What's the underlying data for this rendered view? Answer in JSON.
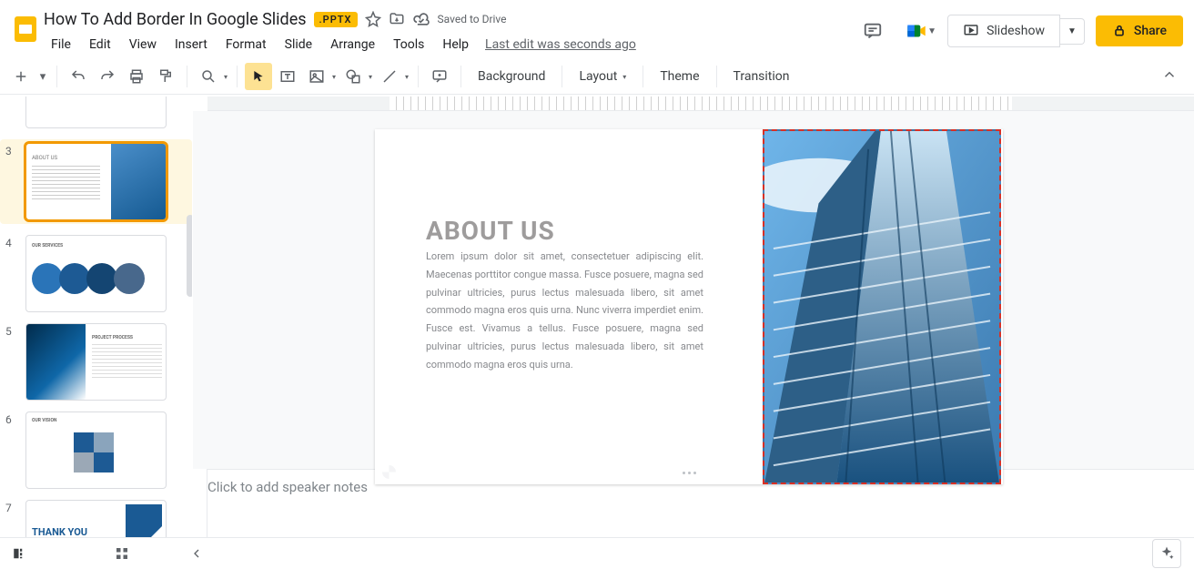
{
  "header": {
    "doc_title": "How To Add Border In Google Slides",
    "badge": ".PPTX",
    "saved_label": "Saved to Drive",
    "last_edit": "Last edit was seconds ago",
    "menus": [
      "File",
      "Edit",
      "View",
      "Insert",
      "Format",
      "Slide",
      "Arrange",
      "Tools",
      "Help"
    ],
    "slideshow_label": "Slideshow",
    "share_label": "Share"
  },
  "toolbar": {
    "background": "Background",
    "layout": "Layout",
    "theme": "Theme",
    "transition": "Transition"
  },
  "thumbnails": [
    {
      "num": "3",
      "title": "ABOUT US",
      "selected": true
    },
    {
      "num": "4",
      "title": "OUR SERVICES"
    },
    {
      "num": "5",
      "title": "PROJECT PROCESS"
    },
    {
      "num": "6",
      "title": "OUR VISION"
    },
    {
      "num": "7",
      "title": "THANK YOU"
    }
  ],
  "slide": {
    "title": "ABOUT US",
    "body": "Lorem ipsum dolor sit amet, consectetuer adipiscing elit. Maecenas porttitor congue massa. Fusce posuere, magna sed pulvinar ultricies, purus lectus malesuada libero, sit amet commodo magna eros quis urna. Nunc viverra imperdiet enim. Fusce est. Vivamus a tellus. Fusce posuere, magna sed pulvinar ultricies, purus lectus malesuada libero, sit amet commodo magna eros quis urna."
  },
  "notes": {
    "placeholder": "Click to add speaker notes"
  }
}
